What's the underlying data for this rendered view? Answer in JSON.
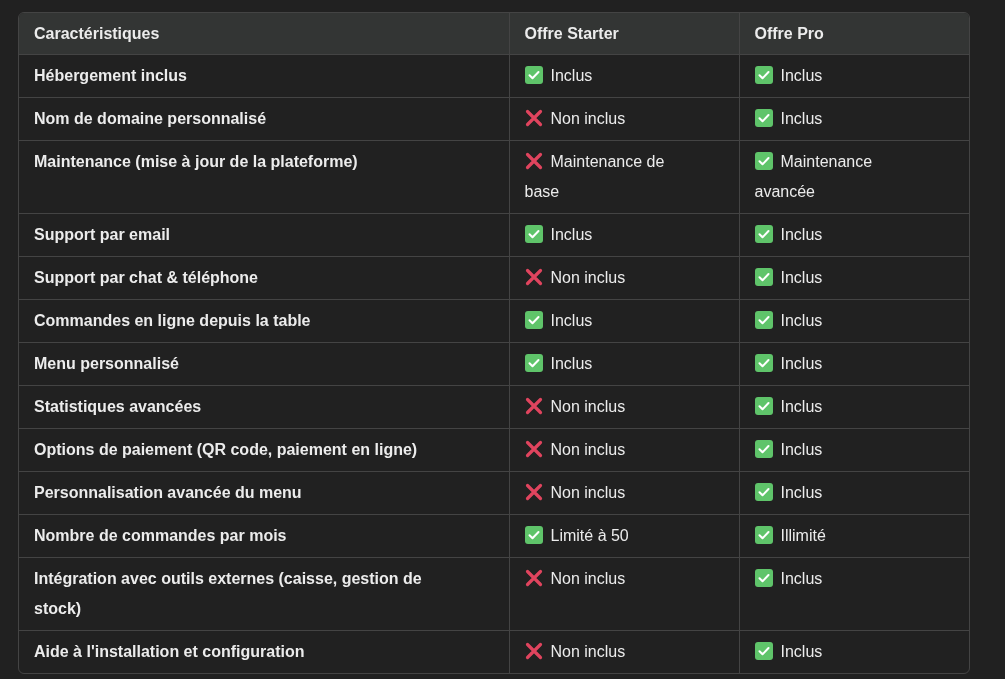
{
  "table": {
    "columns": [
      "Caractéristiques",
      "Offre Starter",
      "Offre Pro"
    ],
    "rows": [
      {
        "cells": [
          {
            "kind": "label",
            "text": "Hébergement inclus"
          },
          {
            "kind": "yes",
            "text": "Inclus"
          },
          {
            "kind": "yes",
            "text": "Inclus"
          }
        ]
      },
      {
        "cells": [
          {
            "kind": "label",
            "text": "Nom de domaine personnalisé"
          },
          {
            "kind": "no",
            "text": "Non inclus"
          },
          {
            "kind": "yes",
            "text": "Inclus"
          }
        ]
      },
      {
        "cells": [
          {
            "kind": "label",
            "text": "Maintenance (mise à jour de la plateforme)"
          },
          {
            "kind": "no",
            "text": "Maintenance de base"
          },
          {
            "kind": "yes",
            "text": "Maintenance avancée"
          }
        ]
      },
      {
        "cells": [
          {
            "kind": "label",
            "text": "Support par email"
          },
          {
            "kind": "yes",
            "text": "Inclus"
          },
          {
            "kind": "yes",
            "text": "Inclus"
          }
        ]
      },
      {
        "cells": [
          {
            "kind": "label",
            "text": "Support par chat & téléphone"
          },
          {
            "kind": "no",
            "text": "Non inclus"
          },
          {
            "kind": "yes",
            "text": "Inclus"
          }
        ]
      },
      {
        "cells": [
          {
            "kind": "label",
            "text": "Commandes en ligne depuis la table"
          },
          {
            "kind": "yes",
            "text": "Inclus"
          },
          {
            "kind": "yes",
            "text": "Inclus"
          }
        ]
      },
      {
        "cells": [
          {
            "kind": "label",
            "text": "Menu personnalisé"
          },
          {
            "kind": "yes",
            "text": "Inclus"
          },
          {
            "kind": "yes",
            "text": "Inclus"
          }
        ]
      },
      {
        "cells": [
          {
            "kind": "label",
            "text": "Statistiques avancées"
          },
          {
            "kind": "no",
            "text": "Non inclus"
          },
          {
            "kind": "yes",
            "text": "Inclus"
          }
        ]
      },
      {
        "cells": [
          {
            "kind": "label",
            "text": "Options de paiement (QR code, paiement en ligne)"
          },
          {
            "kind": "no",
            "text": "Non inclus"
          },
          {
            "kind": "yes",
            "text": "Inclus"
          }
        ]
      },
      {
        "cells": [
          {
            "kind": "label",
            "text": "Personnalisation avancée du menu"
          },
          {
            "kind": "no",
            "text": "Non inclus"
          },
          {
            "kind": "yes",
            "text": "Inclus"
          }
        ]
      },
      {
        "cells": [
          {
            "kind": "label",
            "text": "Nombre de commandes par mois"
          },
          {
            "kind": "yes",
            "text": "Limité à 50"
          },
          {
            "kind": "yes",
            "text": "Illimité"
          }
        ]
      },
      {
        "cells": [
          {
            "kind": "label",
            "text": "Intégration avec outils externes (caisse, gestion de stock)"
          },
          {
            "kind": "no",
            "text": "Non inclus"
          },
          {
            "kind": "yes",
            "text": "Inclus"
          }
        ]
      },
      {
        "cells": [
          {
            "kind": "label",
            "text": "Aide à l'installation et configuration"
          },
          {
            "kind": "no",
            "text": "Non inclus"
          },
          {
            "kind": "yes",
            "text": "Inclus"
          }
        ]
      }
    ]
  }
}
